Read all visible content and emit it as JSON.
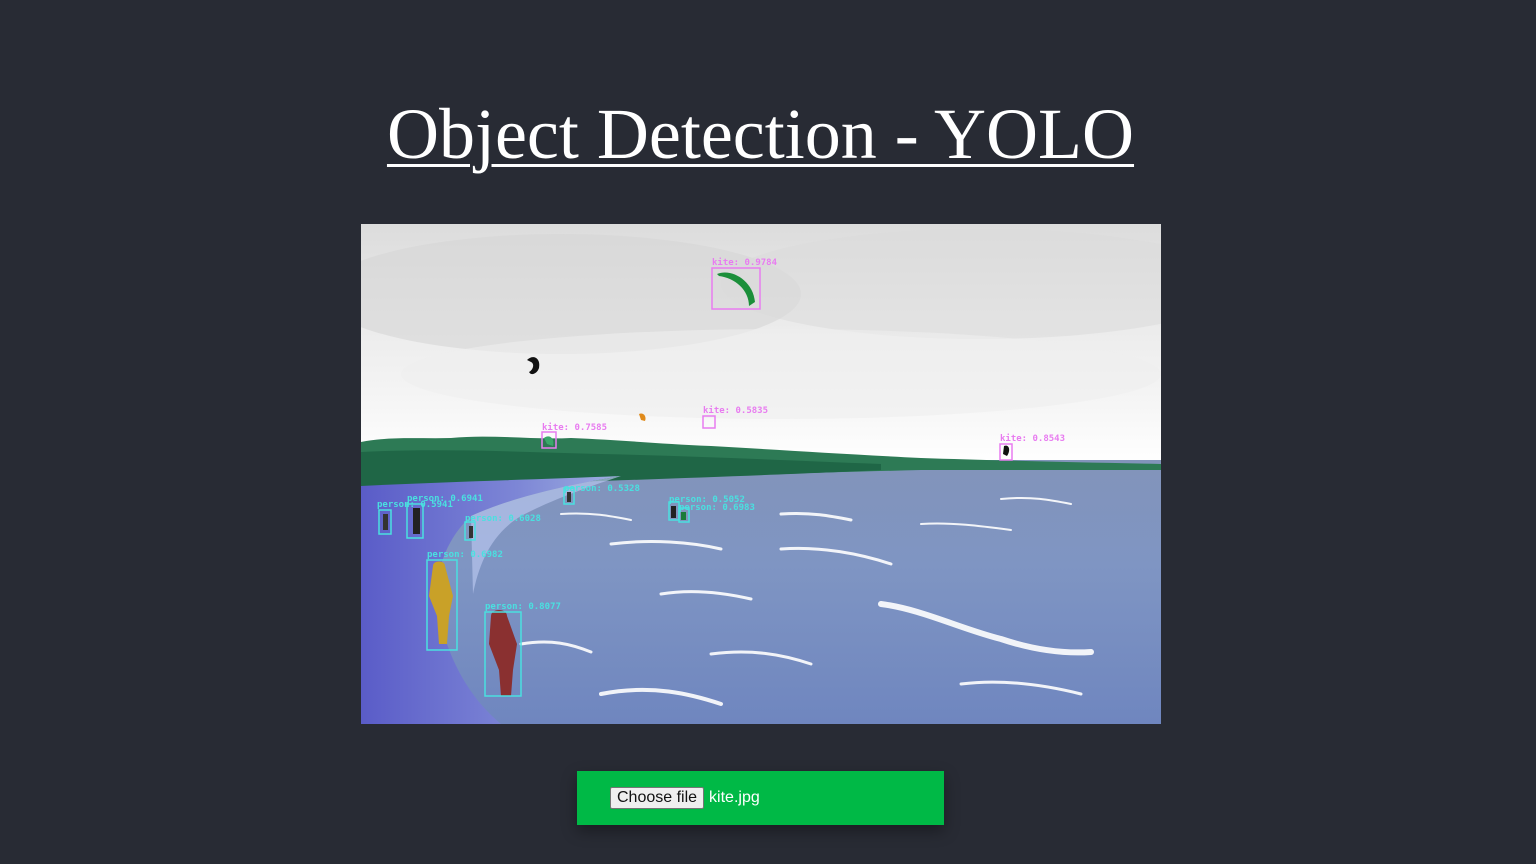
{
  "page": {
    "title": "Object Detection - YOLO"
  },
  "result_image": {
    "kind": "annotated beach photo with detection boxes",
    "kite_box_color": "#e87cf0",
    "person_box_color": "#4ae0e0",
    "detections": [
      {
        "label": "kite: 0.9784",
        "cls": "kite"
      },
      {
        "label": "kite: 0.7585",
        "cls": "kite"
      },
      {
        "label": "kite: 0.5835",
        "cls": "kite"
      },
      {
        "label": "kite: 0.8543",
        "cls": "kite"
      },
      {
        "label": "person: 0.6982",
        "cls": "person"
      },
      {
        "label": "person: 0.8077",
        "cls": "person"
      },
      {
        "label": "person: 0.6941",
        "cls": "person"
      },
      {
        "label": "person: 0.5941",
        "cls": "person"
      },
      {
        "label": "person: 0.6028",
        "cls": "person"
      },
      {
        "label": "person: 0.5328",
        "cls": "person"
      },
      {
        "label": "person: 0.5052",
        "cls": "person"
      },
      {
        "label": "person: 0.6983",
        "cls": "person"
      }
    ]
  },
  "upload": {
    "button_label": "Choose file",
    "file_name": "kite.jpg",
    "bar_color": "#00b946"
  }
}
